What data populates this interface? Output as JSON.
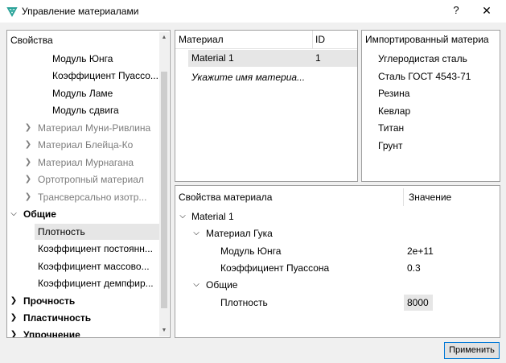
{
  "window": {
    "title": "Управление материалами",
    "help": "?",
    "close": "✕"
  },
  "properties_tree": {
    "header": "Свойства",
    "items": [
      {
        "label": "Модуль Юнга"
      },
      {
        "label": "Коэффициент Пуассо..."
      },
      {
        "label": "Модуль Ламе"
      },
      {
        "label": "Модуль сдвига"
      },
      {
        "label": "Материал Муни-Ривлина"
      },
      {
        "label": "Материал Блейца-Ко"
      },
      {
        "label": "Материал Мурнагана"
      },
      {
        "label": "Ортотропный материал"
      },
      {
        "label": "Трансверсально изотр..."
      },
      {
        "label": "Общие"
      },
      {
        "label": "Плотность"
      },
      {
        "label": "Коэффициент постоянн..."
      },
      {
        "label": "Коэффициент массово..."
      },
      {
        "label": "Коэффициент демпфир..."
      },
      {
        "label": "Прочность"
      },
      {
        "label": "Пластичность"
      },
      {
        "label": "Упрочнение"
      }
    ]
  },
  "material_table": {
    "col_material": "Материал",
    "col_id": "ID",
    "rows": [
      {
        "name": "Material 1",
        "id": "1"
      }
    ],
    "new_placeholder": "Укажите имя материа..."
  },
  "imported": {
    "header": "Импортированный материа",
    "items": [
      "Углеродистая сталь",
      "Сталь ГОСТ 4543-71",
      "Резина",
      "Кевлар",
      "Титан",
      "Грунт"
    ]
  },
  "material_properties": {
    "col_property": "Свойства материала",
    "col_value": "Значение",
    "material": "Material 1",
    "group_hooke": "Материал Гука",
    "young": "Модуль Юнга",
    "young_value": "2e+11",
    "poisson": "Коэффициент Пуассона",
    "poisson_value": "0.3",
    "group_general": "Общие",
    "density": "Плотность",
    "density_value": "8000"
  },
  "apply_button": "Применить"
}
